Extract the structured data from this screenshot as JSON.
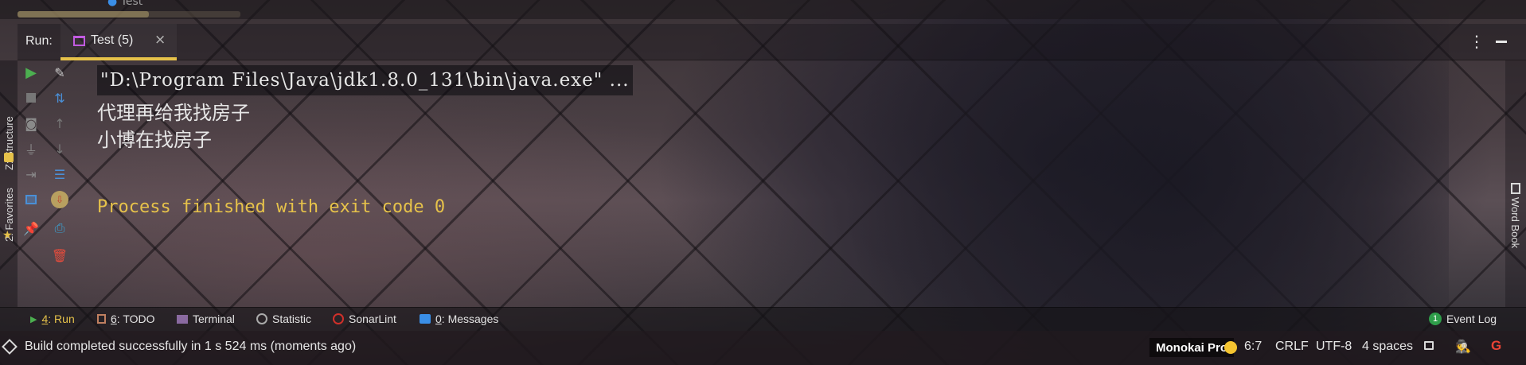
{
  "top_strip": {
    "prev_tab": "Test"
  },
  "run_header": {
    "label": "Run:",
    "tab_label": "Test (5)",
    "tab_close": "×",
    "more_icon": "⋮"
  },
  "console": {
    "command": "\"D:\\Program Files\\Java\\jdk1.8.0_131\\bin\\java.exe\" ...",
    "lines": [
      "代理再给我找房子",
      "小博在找房子"
    ],
    "exit": "Process finished with exit code 0"
  },
  "left_strip": {
    "structure": "Z: Structure",
    "favorites": "2: Favorites"
  },
  "right_strip": {
    "word_book": "Word Book"
  },
  "tool_windows": {
    "run": {
      "key": "4",
      "label": ": Run"
    },
    "todo": {
      "key": "6",
      "label": ": TODO"
    },
    "terminal": "Terminal",
    "statistic": "Statistic",
    "sonarlint": "SonarLint",
    "messages": {
      "key": "0",
      "label": ": Messages"
    },
    "event_log": "Event Log",
    "event_count": "1"
  },
  "status": {
    "build": "Build completed successfully in 1 s 524 ms (moments ago)",
    "theme": "Monokai Pro",
    "position": "6:7",
    "line_sep": "CRLF",
    "encoding": "UTF-8",
    "indent": "4 spaces"
  },
  "colors": {
    "accent": "#e6c24a",
    "run_green": "#4caf50",
    "stop_red": "#e74c3c",
    "tab_purple": "#c15be0",
    "event_green": "#2e9d4a"
  }
}
